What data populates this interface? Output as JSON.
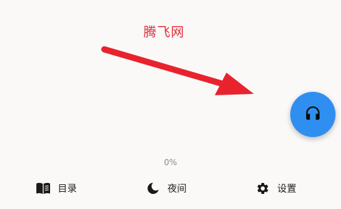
{
  "watermark": {
    "text": "腾飞网",
    "color": "#e0303a"
  },
  "annotation": {
    "icon": "red-arrow",
    "color": "#e8232d"
  },
  "fab": {
    "icon": "headphones-icon",
    "color": "#2f8ff0"
  },
  "progress": {
    "text": "0%"
  },
  "bottom_nav": {
    "items": [
      {
        "label": "目录",
        "icon": "book-icon"
      },
      {
        "label": "夜间",
        "icon": "moon-icon"
      },
      {
        "label": "设置",
        "icon": "gear-icon"
      }
    ]
  }
}
